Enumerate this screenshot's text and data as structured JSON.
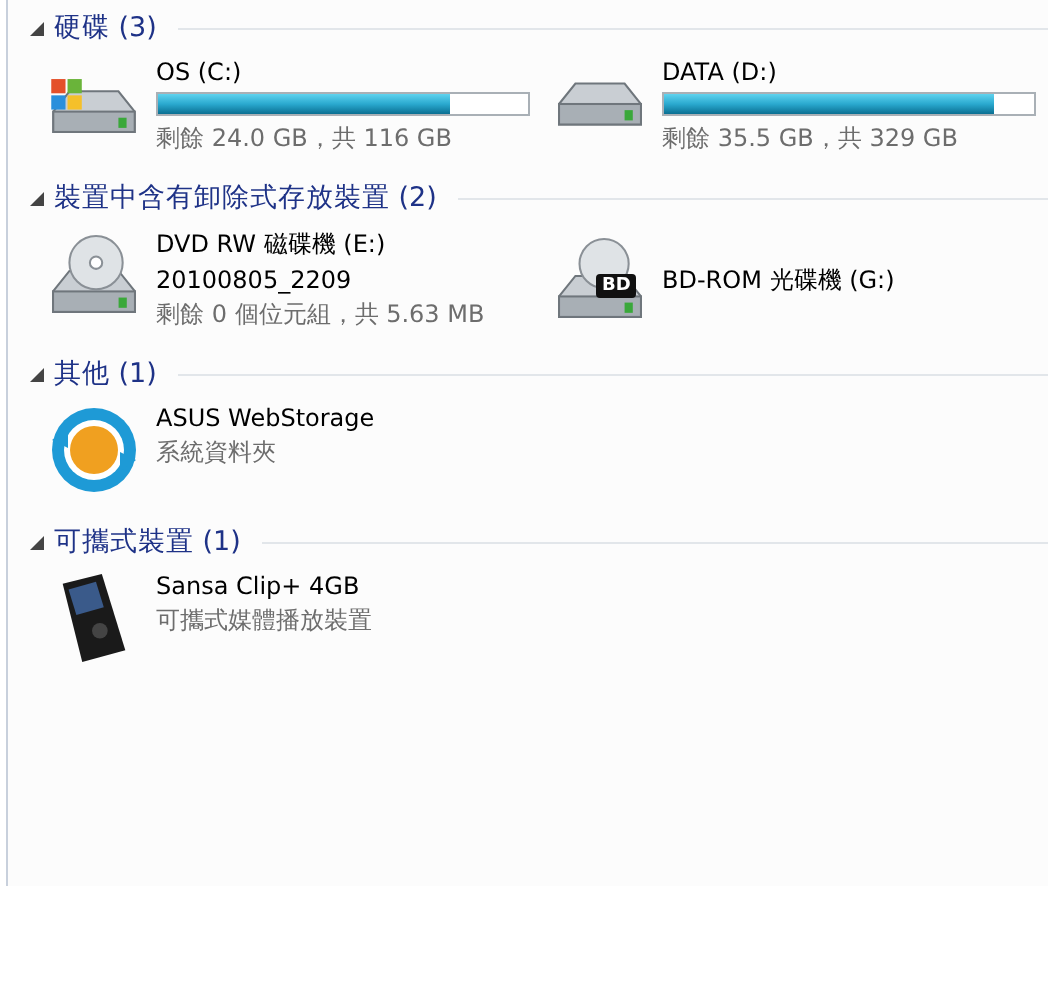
{
  "groups": [
    {
      "title": "硬碟 (3)",
      "expanded": true,
      "items": [
        {
          "kind": "system",
          "name": "OS (C:)",
          "level": 0.79,
          "detail": "剩餘 24.0 GB，共 116 GB"
        },
        {
          "kind": "drive",
          "name": "DATA (D:)",
          "level": 0.89,
          "detail": "剩餘 35.5 GB，共 329 GB"
        }
      ]
    },
    {
      "title": "裝置中含有卸除式存放裝置 (2)",
      "expanded": true,
      "items": [
        {
          "kind": "dvd",
          "name": "DVD RW 磁碟機 (E:)",
          "subtitle": "20100805_2209",
          "detail": "剩餘 0 個位元組，共 5.63 MB"
        },
        {
          "kind": "bluray",
          "name": "BD-ROM 光碟機 (G:)",
          "badge": "BD"
        }
      ]
    },
    {
      "title": "其他 (1)",
      "expanded": true,
      "items": [
        {
          "kind": "cloud",
          "name": "ASUS WebStorage",
          "detail": "系統資料夾"
        }
      ]
    },
    {
      "title": "可攜式裝置 (1)",
      "expanded": true,
      "items": [
        {
          "kind": "player",
          "name": "Sansa Clip+ 4GB",
          "detail": "可攜式媒體播放裝置"
        }
      ]
    }
  ]
}
